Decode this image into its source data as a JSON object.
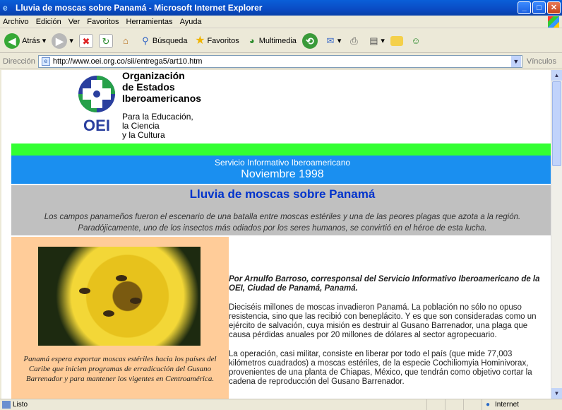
{
  "window": {
    "title": "Lluvia de moscas sobre Panamá - Microsoft Internet Explorer"
  },
  "menu": [
    "Archivo",
    "Edición",
    "Ver",
    "Favoritos",
    "Herramientas",
    "Ayuda"
  ],
  "toolbar": {
    "back": "Atrás",
    "search": "Búsqueda",
    "favorites": "Favoritos",
    "media": "Multimedia"
  },
  "address": {
    "label": "Dirección",
    "url": "http://www.oei.org.co/sii/entrega5/art10.htm",
    "links": "Vínculos"
  },
  "status": {
    "text": "Listo",
    "zone": "Internet"
  },
  "page": {
    "org": {
      "line1": "Organización",
      "line2": "de Estados",
      "line3": "Iberoamericanos",
      "sub1": "Para la Educación,",
      "sub2": "la Ciencia",
      "sub3": "y la Cultura",
      "logo_text": "OEI"
    },
    "service": "Servicio Informativo Iberoamericano",
    "date": "Noviembre 1998",
    "title": "Lluvia de moscas sobre Panamá",
    "lead": "Los campos panameños fueron el escenario de una batalla entre moscas estériles y una de las peores plagas que azota a la región. Paradójicamente, uno de los insectos más odiados por los seres humanos, se convirtió en el héroe de esta lucha.",
    "caption": "Panamá espera exportar moscas estériles hacia los países del Caribe que inicien programas de erradicación del Gusano Barrenador y para mantener los vigentes en Centroamérica.",
    "byline": "Por Arnulfo Barroso, corresponsal del Servicio Informativo Iberoamericano de la OEI, Ciudad de Panamá, Panamá.",
    "p1": "Dieciséis millones de moscas invadieron Panamá. La población no sólo no opuso resistencia, sino que las recibió con beneplácito. Y es que son consideradas como un ejército de salvación, cuya misión es destruir al Gusano Barrenador, una plaga que causa pérdidas anuales por 20 millones de dólares al sector agropecuario.",
    "p2": "La operación, casi militar, consiste en liberar por todo el país (que mide 77,003 kilómetros cuadrados) a moscas estériles, de la especie Cochiliomyia Hominivorax, provenientes de una planta de Chiapas, México, que tendrán como objetivo cortar la cadena de reproducción del Gusano Barrenador."
  }
}
